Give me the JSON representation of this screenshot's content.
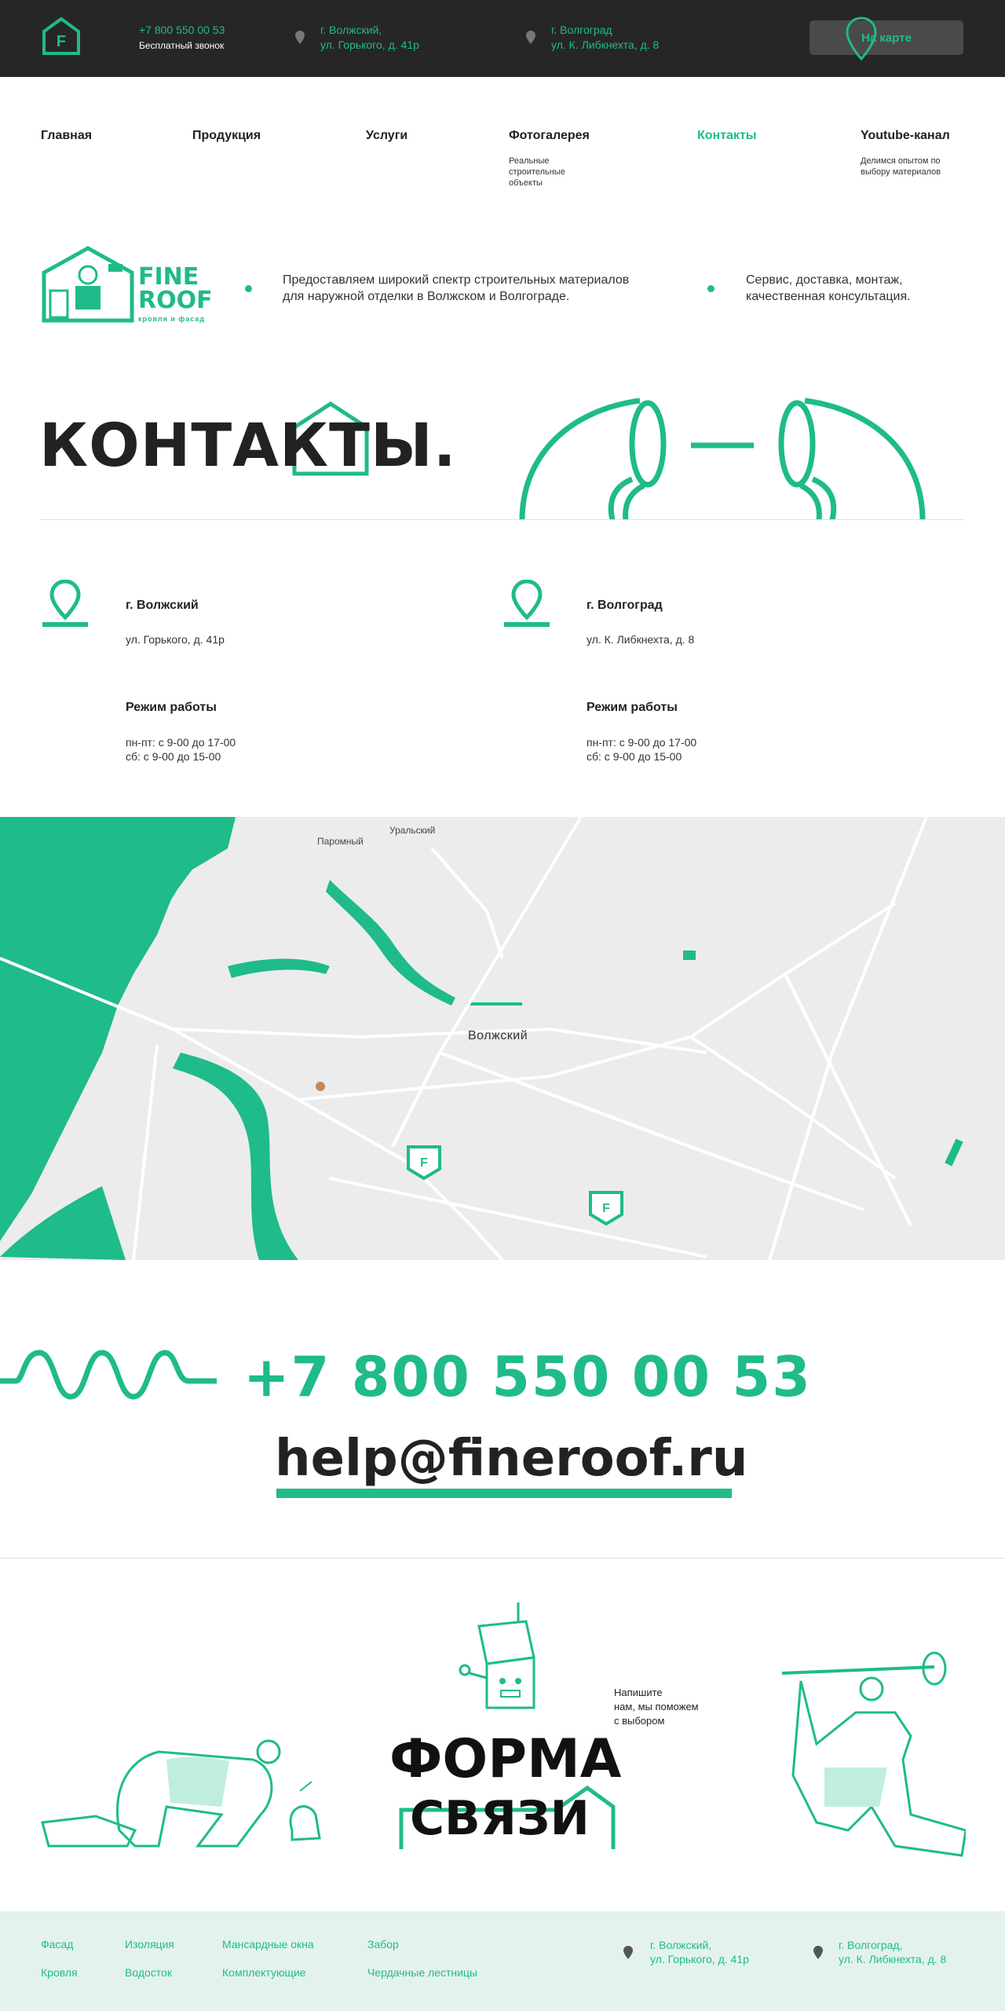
{
  "topbar": {
    "phone": "+7 800 550 00 53",
    "phone_note": "Бесплатный звонок",
    "addr1_line1": "г. Волжский,",
    "addr1_line2": "ул. Горького, д. 41р",
    "addr2_line1": "г. Волгоград",
    "addr2_line2": "ул. К. Либкнехта, д. 8",
    "map_button": "На карте"
  },
  "nav": {
    "items": [
      {
        "label": "Главная"
      },
      {
        "label": "Продукция"
      },
      {
        "label": "Услуги"
      },
      {
        "label": "Фотогалерея",
        "sub": "Реальные строительные объекты"
      },
      {
        "label": "Контакты"
      },
      {
        "label": "Youtube-канал",
        "sub": "Делимся опытом по выбору материалов"
      }
    ]
  },
  "logo": {
    "line1": "FINE",
    "line2": "ROOF",
    "tagline": "кровля и фасад",
    "badge": "F"
  },
  "intro": {
    "text1_line1": "Предоставляем широкий спектр строительных материалов",
    "text1_line2": "для наружной отделки в Волжском и Волгограде.",
    "text2_line1": "Сервис, доставка, монтаж,",
    "text2_line2": "качественная консультация."
  },
  "contacts": {
    "title": "КОНТАКТЫ.",
    "offices": [
      {
        "city": "г. Волжский",
        "address": "ул. Горького, д. 41р",
        "schedule_title": "Режим работы",
        "schedule_line1": "пн-пт: с 9-00 до 17-00",
        "schedule_line2": "сб: с 9-00 до 15-00"
      },
      {
        "city": "г. Волгоград",
        "address": "ул. К. Либкнехта, д. 8",
        "schedule_title": "Режим работы",
        "schedule_line1": "пн-пт: с 9-00 до 17-00",
        "schedule_line2": "сб: с 9-00 до 15-00"
      }
    ]
  },
  "map": {
    "city_label": "Волжский",
    "place1": "Паромный",
    "place2": "Уральский",
    "marker_letter": "F"
  },
  "contact_big": {
    "phone": "+7 800 550 00 53",
    "email": "help@fineroof.ru"
  },
  "form": {
    "word1": "ФОРМА",
    "word2": "СВЯЗИ",
    "note_line1": "Напишите",
    "note_line2": "нам, мы поможем",
    "note_line3": "с выбором"
  },
  "footer": {
    "links": [
      {
        "label": "Фасад"
      },
      {
        "label": "Кровля"
      },
      {
        "label": "Изоляция"
      },
      {
        "label": "Водосток"
      },
      {
        "label": "Мансардные окна"
      },
      {
        "label": "Комплектующие"
      },
      {
        "label": "Забор"
      },
      {
        "label": "Чердачные лестницы"
      }
    ],
    "addr1_line1": "г. Волжский,",
    "addr1_line2": "ул. Горького, д. 41р",
    "addr2_line1": "г. Волгоград,",
    "addr2_line2": "ул. К. Либкнехта, д. 8"
  },
  "colors": {
    "accent": "#1fbb8a",
    "dark": "#262626",
    "footer_bg": "#e3f2ed"
  }
}
